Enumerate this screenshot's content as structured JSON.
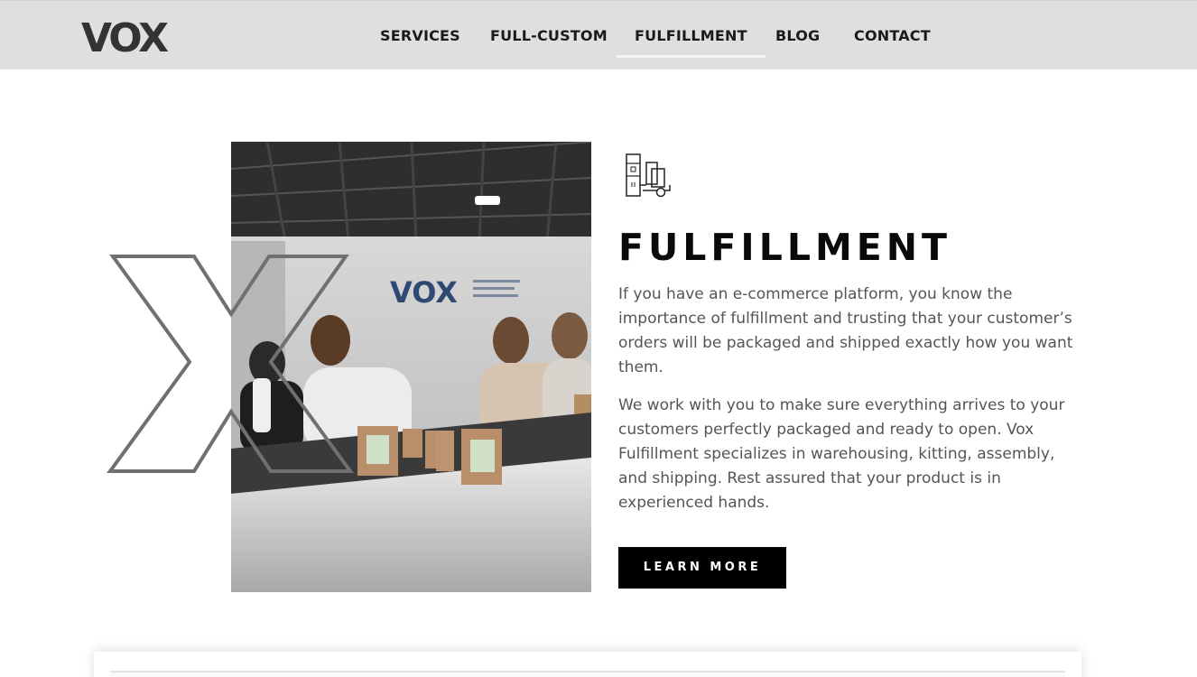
{
  "header": {
    "logo_text": "VOX",
    "nav": [
      {
        "label": "SERVICES"
      },
      {
        "label": "FULL-CUSTOM"
      },
      {
        "label": "FULFILLMENT",
        "active": true
      },
      {
        "label": "BLOG"
      },
      {
        "label": "CONTACT"
      }
    ]
  },
  "hero": {
    "photo_sign": "VOX",
    "icon": "warehouse-hand-truck-icon",
    "title": "FULFILLMENT",
    "paragraphs": [
      "If you have an e-commerce platform, you know the importance of fulfillment and trusting that your customer’s orders will be packaged and shipped exactly how you want them.",
      "We work with you to make sure everything arrives to your customers perfectly packaged and ready to open. Vox Fulfillment specializes in warehousing, kitting, assembly, and shipping. Rest assured that your product is in experienced hands."
    ],
    "cta_label": "LEARN MORE"
  },
  "colors": {
    "header_bg": "#dfdfdf",
    "button_bg": "#000000",
    "body_text": "#555555"
  }
}
